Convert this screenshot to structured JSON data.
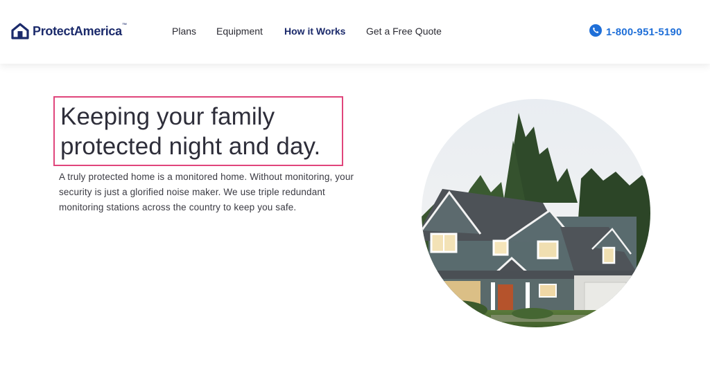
{
  "brand": {
    "name": "ProtectAmerica",
    "trademark": "™",
    "color": "#1b2a6b"
  },
  "nav": {
    "items": [
      {
        "label": "Plans",
        "active": false
      },
      {
        "label": "Equipment",
        "active": false
      },
      {
        "label": "How it Works",
        "active": true
      },
      {
        "label": "Get a Free Quote",
        "active": false
      }
    ],
    "active_color": "#1b2a6b"
  },
  "contact": {
    "phone": "1-800-951-5190",
    "icon": "phone-icon",
    "color": "#1f6fd8"
  },
  "hero": {
    "headline_line1": "Keeping your family",
    "headline_line2": "protected night and day.",
    "highlight_color": "#e0457b",
    "body": "A truly protected home is a monitored home. Without monitoring, your security is just a glorified noise maker. We use triple redundant monitoring stations across the country to keep you safe.",
    "image": "house-at-dusk-photo"
  }
}
